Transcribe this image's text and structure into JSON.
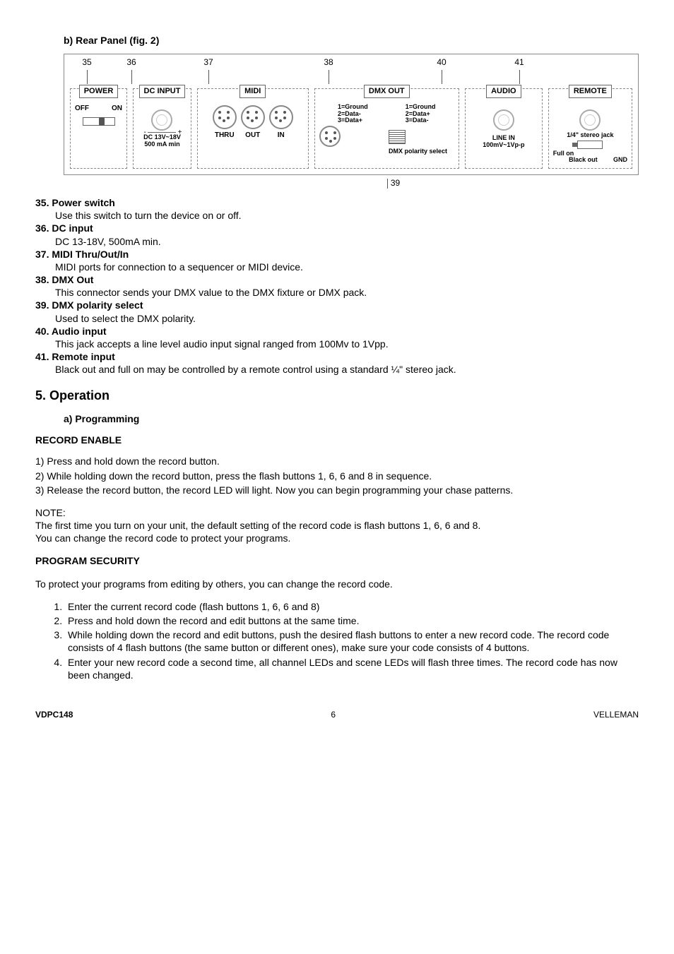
{
  "section_b": "b)  Rear Panel (fig. 2)",
  "callouts": {
    "c35": "35",
    "c36": "36",
    "c37": "37",
    "c38": "38",
    "c39": "39",
    "c40": "40",
    "c41": "41"
  },
  "panel": {
    "power": {
      "title": "POWER",
      "off": "OFF",
      "on": "ON"
    },
    "dcinput": {
      "title": "DC INPUT",
      "spec": "DC 13V~18V\n500 mA min"
    },
    "midi": {
      "title": "MIDI",
      "thru": "THRU",
      "out": "OUT",
      "in": "IN"
    },
    "dmx": {
      "title": "DMX OUT",
      "pin_a": "1=Ground\n2=Data-\n3=Data+",
      "pin_b": "1=Ground\n2=Data+\n3=Data-",
      "sel": "DMX polarity select"
    },
    "audio": {
      "title": "AUDIO",
      "line": "LINE IN",
      "spec": "100mV~1Vp-p"
    },
    "remote": {
      "title": "REMOTE",
      "jack": "1/4\" stereo jack",
      "full": "Full on",
      "blk": "Black out",
      "gnd": "GND"
    }
  },
  "defs": {
    "d35h": "35. Power switch",
    "d35b": "Use this switch to turn the device on or off.",
    "d36h": "36. DC input",
    "d36b": "DC 13-18V, 500mA min.",
    "d37h": "37. MIDI Thru/Out/In",
    "d37b": "MIDI ports for connection to a sequencer or MIDI device.",
    "d38h": "38. DMX Out",
    "d38b": "This connector sends your DMX value to the DMX fixture or DMX pack.",
    "d39h": "39. DMX polarity select",
    "d39b": "Used to select the DMX polarity.",
    "d40h": "40. Audio input",
    "d40b": "This jack accepts a line level audio input signal ranged from 100Mv to 1Vpp.",
    "d41h": "41. Remote input",
    "d41b": "Black out and full on may be controlled by a remote control using a standard ¼\" stereo jack."
  },
  "operation_head": "5.  Operation",
  "sub_a": "a)  Programming",
  "rec_enable_head": "RECORD ENABLE",
  "rec_steps": {
    "s1": "1) Press and hold down the record button.",
    "s2": "2) While holding down the record button, press the flash buttons 1, 6, 6 and 8 in sequence.",
    "s3": "3) Release the record button, the record LED will light. Now you can begin programming your chase patterns."
  },
  "note_head": "NOTE:",
  "note_l1": "The first time you turn on your unit, the default setting of the record code is flash buttons 1, 6, 6 and 8.",
  "note_l2": "You can change the record code to protect your programs.",
  "prog_sec_head": "PROGRAM SECURITY",
  "prog_intro": "To protect your programs from editing by others, you can change the record code.",
  "prog_list": {
    "i1": "Enter the current record code (flash buttons 1, 6, 6 and 8)",
    "i2": "Press and hold down the record and edit buttons at the same time.",
    "i3": "While holding down the record and edit buttons, push the desired flash buttons to enter a new record code. The record code consists of 4 flash buttons (the same button or different ones), make sure your code consists of 4 buttons.",
    "i4": "Enter your new record code a second time, all channel LEDs and scene LEDs will flash three times. The record code has now been changed."
  },
  "footer": {
    "model": "VDPC148",
    "page": "6",
    "brand": "VELLEMAN"
  }
}
